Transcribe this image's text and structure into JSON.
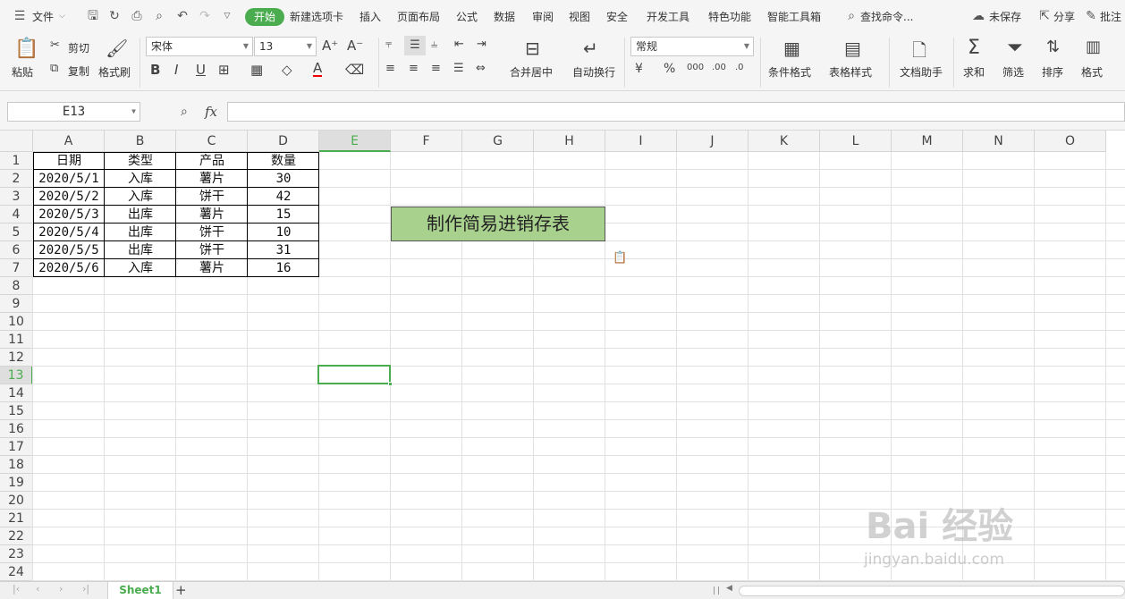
{
  "menu": {
    "file": "文件",
    "tabs": [
      "开始",
      "新建选项卡",
      "插入",
      "页面布局",
      "公式",
      "数据",
      "审阅",
      "视图",
      "安全",
      "开发工具",
      "特色功能",
      "智能工具箱"
    ],
    "search": "查找命令...",
    "unsaved": "未保存",
    "share": "分享",
    "comment": "批注"
  },
  "ribbon": {
    "paste": "粘贴",
    "cut": "剪切",
    "copy": "复制",
    "format_painter": "格式刷",
    "font_name": "宋体",
    "font_size": "13",
    "merge_center": "合并居中",
    "wrap_text": "自动换行",
    "number_format": "常规",
    "cond_format": "条件格式",
    "table_style": "表格样式",
    "doc_helper": "文档助手",
    "sum": "求和",
    "filter": "筛选",
    "sort": "排序",
    "format": "格式"
  },
  "formula_bar": {
    "cell_ref": "E13",
    "fx": "fx",
    "content": ""
  },
  "sheet": {
    "columns": [
      "A",
      "B",
      "C",
      "D",
      "E",
      "F",
      "G",
      "H",
      "I",
      "J",
      "K",
      "L",
      "M",
      "N",
      "O"
    ],
    "rows": [
      "1",
      "2",
      "3",
      "4",
      "5",
      "6",
      "7",
      "8",
      "9",
      "10",
      "11",
      "12",
      "13",
      "14",
      "15",
      "16",
      "17",
      "18",
      "19",
      "20",
      "21",
      "22",
      "23",
      "24"
    ],
    "table_header": [
      "日期",
      "类型",
      "产品",
      "数量"
    ],
    "table_rows": [
      [
        "2020/5/1",
        "入库",
        "薯片",
        "30"
      ],
      [
        "2020/5/2",
        "入库",
        "饼干",
        "42"
      ],
      [
        "2020/5/3",
        "出库",
        "薯片",
        "15"
      ],
      [
        "2020/5/4",
        "出库",
        "饼干",
        "10"
      ],
      [
        "2020/5/5",
        "出库",
        "饼干",
        "31"
      ],
      [
        "2020/5/6",
        "入库",
        "薯片",
        "16"
      ]
    ],
    "title_box": "制作简易进销存表",
    "title_box_color": "#a9d18e",
    "selected_cell": "E13"
  },
  "sheet_tabs": {
    "active": "Sheet1",
    "add": "+"
  },
  "watermark": {
    "text": "Bai 经验",
    "sub": "jingyan.baidu.com"
  },
  "colors": {
    "accent": "#4bac4f"
  }
}
